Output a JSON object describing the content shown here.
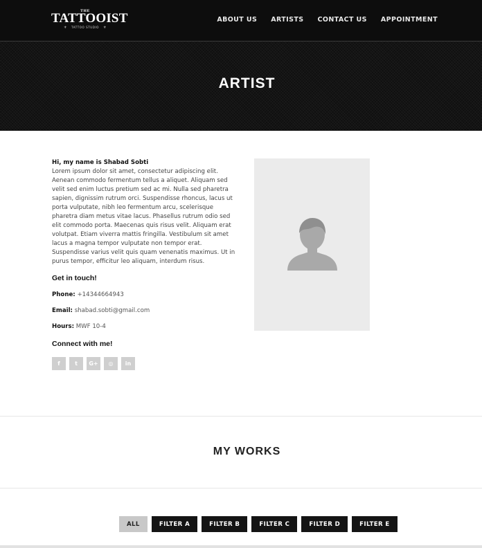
{
  "brand": {
    "logo_top": "THE",
    "logo_main": "TATTOOIST",
    "logo_sub": "TATTOO STUDIO"
  },
  "nav": {
    "items": [
      "ABOUT US",
      "ARTISTS",
      "CONTACT US",
      "APPOINTMENT"
    ]
  },
  "hero": {
    "title": "ARTIST"
  },
  "bio": {
    "intro": "Hi, my name is Shabad Sobti",
    "text": "Lorem ipsum dolor sit amet, consectetur adipiscing elit. Aenean commodo fermentum tellus a aliquet. Aliquam sed velit sed enim luctus pretium sed ac mi. Nulla sed pharetra sapien, dignissim rutrum orci. Suspendisse rhoncus, lacus ut porta vulputate, nibh leo fermentum arcu, scelerisque pharetra diam metus vitae lacus. Phasellus rutrum odio sed elit commodo porta. Maecenas quis risus velit. Aliquam erat volutpat. Etiam viverra mattis fringilla. Vestibulum sit amet lacus a magna tempor vulputate non tempor erat. Suspendisse varius velit quis quam venenatis maximus. Ut in purus tempor, efficitur leo aliquam, interdum risus."
  },
  "contact": {
    "heading": "Get in touch!",
    "phone_label": "Phone:",
    "phone_value": "+14344664943",
    "email_label": "Email:",
    "email_value": "shabad.sobti@gmail.com",
    "hours_label": "Hours:",
    "hours_value": "MWF 10-4"
  },
  "social": {
    "heading": "Connect with me!",
    "icons": [
      {
        "name": "facebook-icon",
        "glyph": "f"
      },
      {
        "name": "twitter-icon",
        "glyph": "t"
      },
      {
        "name": "google-plus-icon",
        "glyph": "G+"
      },
      {
        "name": "instagram-icon",
        "glyph": "◎"
      },
      {
        "name": "linkedin-icon",
        "glyph": "in"
      }
    ]
  },
  "works": {
    "title": "MY WORKS",
    "filters": [
      "ALL",
      "FILTER A",
      "FILTER B",
      "FILTER C",
      "FILTER D",
      "FILTER E"
    ],
    "active_filter": "ALL"
  },
  "colors": {
    "header_bg": "#141414",
    "placeholder_bg": "#ebebeb",
    "avatar": "#a9a9a9",
    "social_bg": "#cfcfcf",
    "filter_bg": "#141414",
    "filter_active_bg": "#c8c8c8"
  }
}
